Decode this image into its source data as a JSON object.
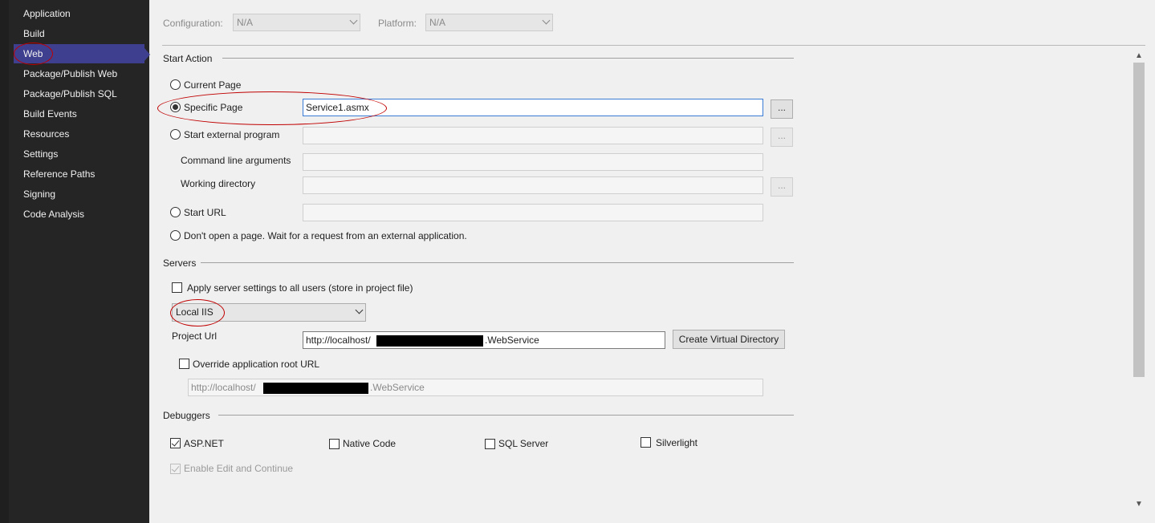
{
  "sidebar": {
    "items": [
      {
        "label": "Application"
      },
      {
        "label": "Build"
      },
      {
        "label": "Web"
      },
      {
        "label": "Package/Publish Web"
      },
      {
        "label": "Package/Publish SQL"
      },
      {
        "label": "Build Events"
      },
      {
        "label": "Resources"
      },
      {
        "label": "Settings"
      },
      {
        "label": "Reference Paths"
      },
      {
        "label": "Signing"
      },
      {
        "label": "Code Analysis"
      }
    ],
    "selected": "Web"
  },
  "toolbar": {
    "configuration_label": "Configuration:",
    "configuration_value": "N/A",
    "platform_label": "Platform:",
    "platform_value": "N/A"
  },
  "start_action": {
    "heading": "Start Action",
    "current_page": "Current Page",
    "specific_page": "Specific Page",
    "specific_page_value": "Service1.asmx",
    "start_external_program": "Start external program",
    "command_line_arguments": "Command line arguments",
    "working_directory": "Working directory",
    "start_url": "Start URL",
    "dont_open": "Don't open a page.  Wait for a request from an external application.",
    "browse_label": "..."
  },
  "servers": {
    "heading": "Servers",
    "apply_all_users": "Apply server settings to all users (store in project file)",
    "server_type": "Local IIS",
    "project_url_label": "Project Url",
    "project_url_prefix": "http://localhost/",
    "project_url_suffix": ".WebService",
    "create_virtual_directory": "Create Virtual Directory",
    "override_root_url": "Override application root URL",
    "root_url_prefix": "http://localhost/",
    "root_url_suffix": ".WebService"
  },
  "debuggers": {
    "heading": "Debuggers",
    "aspnet": "ASP.NET",
    "native_code": "Native Code",
    "sql_server": "SQL Server",
    "silverlight": "Silverlight",
    "enable_edit_continue": "Enable Edit and Continue"
  },
  "colors": {
    "sidebar_bg": "#252526",
    "sidebar_selected": "#3f3f8f",
    "annotation": "#c00000"
  }
}
